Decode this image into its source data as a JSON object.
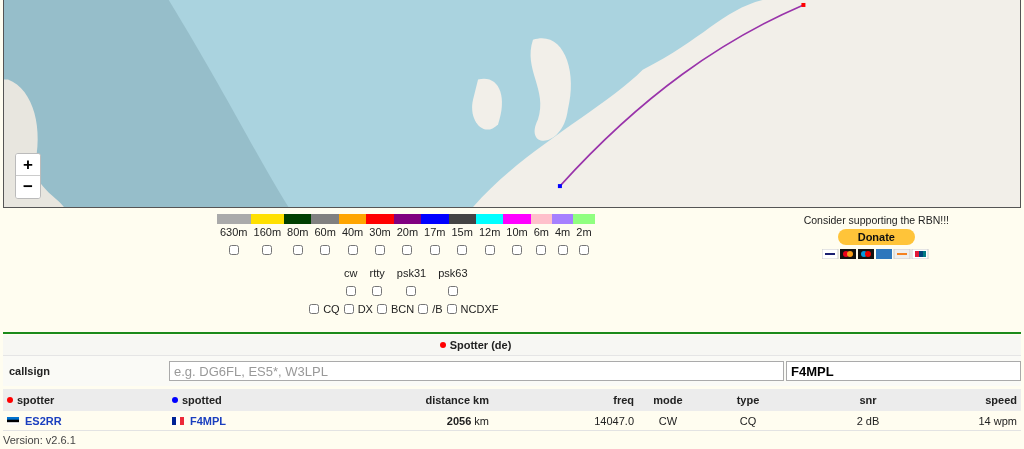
{
  "map": {
    "zoom_controls": [
      "+",
      "−"
    ]
  },
  "bands": [
    {
      "label": "630m",
      "color": "#aaaaaa",
      "checked": false
    },
    {
      "label": "160m",
      "color": "#ffe000",
      "checked": false
    },
    {
      "label": "80m",
      "color": "#003f00",
      "checked": false
    },
    {
      "label": "60m",
      "color": "#808080",
      "checked": false
    },
    {
      "label": "40m",
      "color": "#ffa500",
      "checked": false
    },
    {
      "label": "30m",
      "color": "#ff0000",
      "checked": false
    },
    {
      "label": "20m",
      "color": "#800080",
      "checked": false
    },
    {
      "label": "17m",
      "color": "#0000ff",
      "checked": false
    },
    {
      "label": "15m",
      "color": "#444444",
      "checked": false
    },
    {
      "label": "12m",
      "color": "#00ffff",
      "checked": false
    },
    {
      "label": "10m",
      "color": "#ff00ff",
      "checked": false
    },
    {
      "label": "6m",
      "color": "#ffc0cb",
      "checked": false
    },
    {
      "label": "4m",
      "color": "#a680ff",
      "checked": false
    },
    {
      "label": "2m",
      "color": "#90ff80",
      "checked": false
    }
  ],
  "modes": [
    {
      "label": "cw",
      "checked": false
    },
    {
      "label": "rtty",
      "checked": false
    },
    {
      "label": "psk31",
      "checked": false
    },
    {
      "label": "psk63",
      "checked": false
    }
  ],
  "types": [
    {
      "label": "CQ",
      "checked": false
    },
    {
      "label": "DX",
      "checked": false
    },
    {
      "label": "BCN",
      "checked": false
    },
    {
      "label": "/B",
      "checked": false
    },
    {
      "label": "NCDXF",
      "checked": false
    }
  ],
  "support": {
    "text": "Consider supporting the RBN!!!",
    "button": "Donate"
  },
  "spotter_panel": {
    "title": "Spotter (de)",
    "callsign_label": "callsign",
    "search": {
      "placeholder": "e.g. DG6FL, ES5*, W3LPL"
    },
    "filter": {
      "value": "F4MPL"
    }
  },
  "table": {
    "columns": [
      {
        "label": "spotter",
        "color": "#ff0000"
      },
      {
        "label": "spotted",
        "color": "#0000ff"
      },
      {
        "label": "distance km"
      },
      {
        "label": "freq"
      },
      {
        "label": "mode"
      },
      {
        "label": "type"
      },
      {
        "label": "snr"
      },
      {
        "label": "speed"
      }
    ],
    "rows": [
      {
        "cells": [
          "ES2RR",
          "F4MPL",
          "**2056** km",
          "14047.0",
          "CW",
          "CQ",
          "2 dB",
          "14 wpm"
        ]
      }
    ]
  },
  "version": "Version: v2.6.1"
}
